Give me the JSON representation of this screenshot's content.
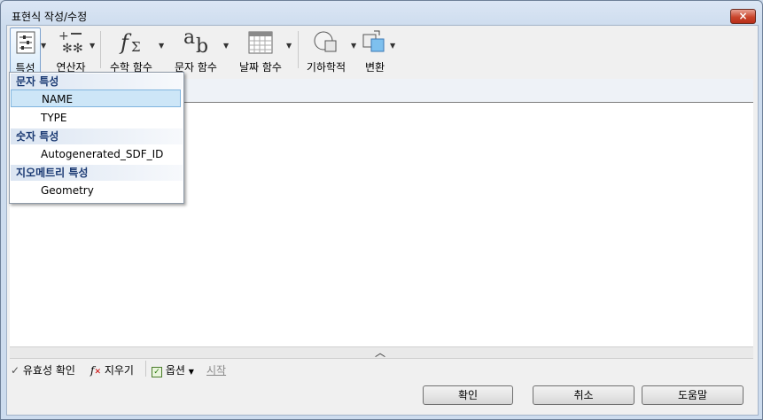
{
  "window": {
    "title": "표현식 작성/수정",
    "close": "×"
  },
  "toolbar": {
    "properties": "특성",
    "operators": "연산자",
    "math": "수학 함수",
    "string": "문자 함수",
    "date": "날짜 함수",
    "geometry": "기하학적",
    "convert": "변환"
  },
  "dropdown": {
    "string_header": "문자 특성",
    "name": "NAME",
    "type": "TYPE",
    "number_header": "숫자 특성",
    "sdf_id": "Autogenerated_SDF_ID",
    "geometry_header": "지오메트리 특성",
    "geometry": "Geometry"
  },
  "bottom": {
    "validate": "유효성 확인",
    "clear": "지우기",
    "options": "옵션",
    "start": "시작"
  },
  "buttons": {
    "ok": "확인",
    "cancel": "취소",
    "help": "도움말"
  },
  "colors": {
    "accent": "#1b3a73",
    "highlight": "#cde6f7"
  }
}
